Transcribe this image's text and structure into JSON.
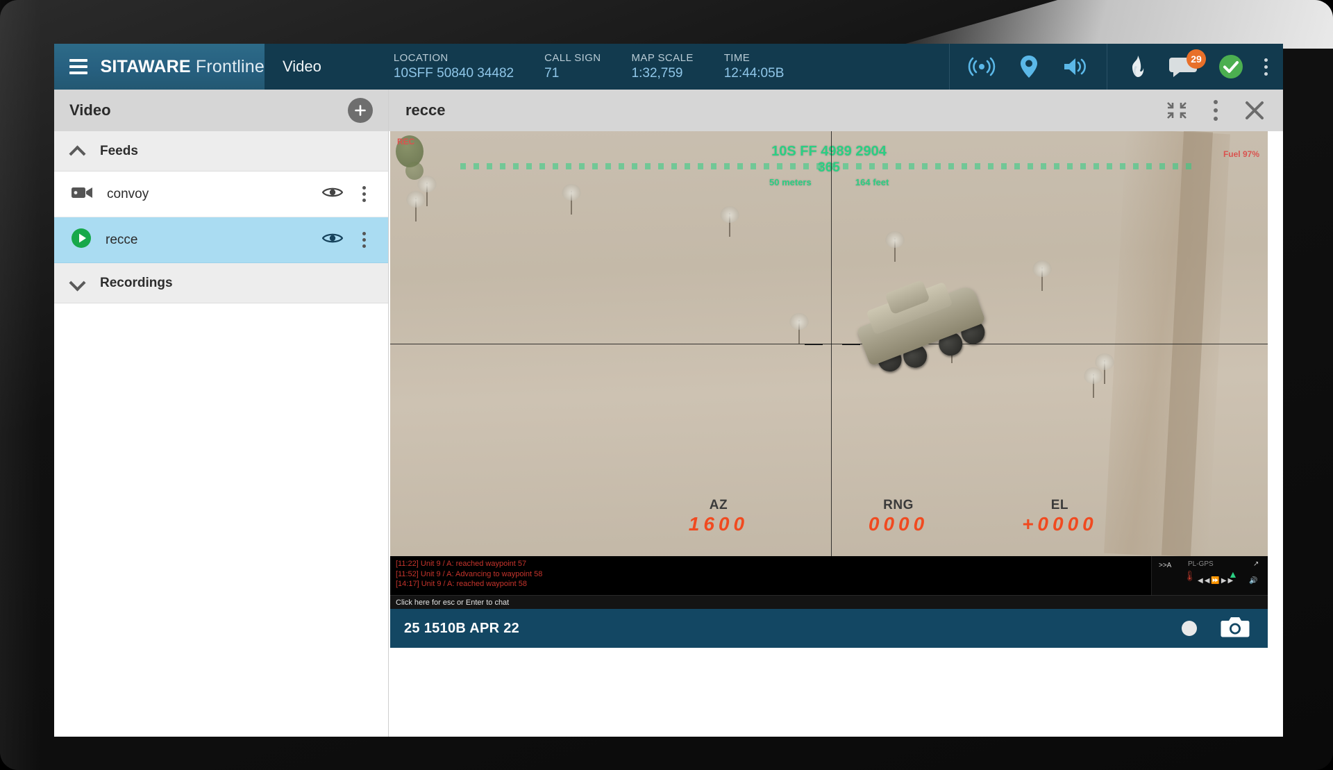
{
  "appbar": {
    "brand_bold": "SITAWARE",
    "brand_light": "Frontline",
    "module_title": "Video",
    "menu_icon": "hamburger-icon",
    "status": [
      {
        "label": "LOCATION",
        "value": "10SFF 50840 34482"
      },
      {
        "label": "CALL SIGN",
        "value": "71"
      },
      {
        "label": "MAP SCALE",
        "value": "1:32,759"
      },
      {
        "label": "TIME",
        "value": "12:44:05B"
      }
    ],
    "quick_icons": [
      "broadcast-icon",
      "location-pin-icon",
      "speaker-icon"
    ],
    "right_icons": [
      "flame-icon",
      "chat-icon",
      "status-ok-icon",
      "overflow-menu-icon"
    ],
    "chat_badge": "29",
    "accent_blue": "#5bb8e8",
    "bar_color": "#123a4e",
    "brand_color": "#2d6b88",
    "badge_color": "#e8702a",
    "ok_color": "#4caf50"
  },
  "sidebar": {
    "title": "Video",
    "add_button_label": "+",
    "groups": [
      {
        "label": "Feeds",
        "icon": "chevron-up-icon",
        "expanded": true
      },
      {
        "label": "Recordings",
        "icon": "chevron-down-icon",
        "expanded": false
      }
    ],
    "feeds": [
      {
        "label": "convoy",
        "icon": "video-camera-icon",
        "selected": false,
        "eye": "eye-icon",
        "menu": "overflow-menu-icon"
      },
      {
        "label": "recce",
        "icon": "play-circle-icon",
        "selected": true,
        "eye": "eye-icon",
        "menu": "overflow-menu-icon"
      }
    ],
    "selected_color": "#aadcf2"
  },
  "video_panel": {
    "title": "recce",
    "header_icons": [
      "collapse-icon",
      "overflow-menu-icon",
      "close-icon"
    ],
    "hud": {
      "grid_ref": "10S FF 4989 2904",
      "heading": "365",
      "scale_left": "50 meters",
      "scale_right": "164 feet",
      "corner_left": "REC",
      "fuel": "Fuel 97%"
    },
    "readouts": [
      {
        "label": "AZ",
        "value": "1600"
      },
      {
        "label": "RNG",
        "value": "0000"
      },
      {
        "label": "EL",
        "value": "+0000"
      }
    ],
    "readout_color": "#f04a20",
    "hud_color": "#2bcf83",
    "chat_log": [
      "[11:22] Unit 9 / A: reached waypoint 57",
      "[11:52] Unit 9 / A: Advancing to waypoint 58",
      "[14:17] Unit 9 / A: reached waypoint 58"
    ],
    "chat_placeholder": "Click here for esc or Enter to chat",
    "timestamp": "25 1510B APR 22",
    "record_button": "record-button",
    "snapshot_button": "camera-icon"
  }
}
